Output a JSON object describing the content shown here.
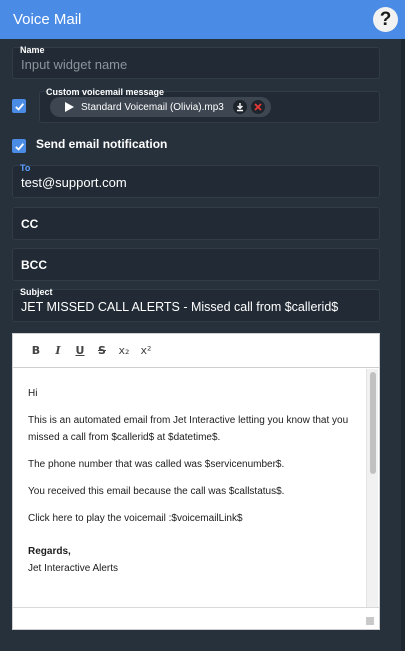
{
  "title": "Voice Mail",
  "help_icon": "?",
  "name_field": {
    "label": "Name",
    "placeholder": "Input widget name"
  },
  "custom_voicemail": {
    "label": "Custom voicemail message",
    "file_name": "Standard Voicemail (Olivia).mp3",
    "checked": true
  },
  "send_email": {
    "label": "Send email notification",
    "checked": true
  },
  "to_field": {
    "label": "To",
    "value": "test@support.com"
  },
  "cc_field": {
    "label": "CC"
  },
  "bcc_field": {
    "label": "BCC"
  },
  "subject_field": {
    "label": "Subject",
    "value": "JET MISSED CALL ALERTS - Missed call from $callerid$"
  },
  "editor": {
    "toolbar": {
      "bold": "B",
      "italic": "I",
      "underline": "U",
      "strike": "S",
      "subscript": "x₂",
      "superscript": "x²"
    },
    "body": {
      "greeting": "Hi",
      "line1": "This is an automated email from Jet Interactive letting you know that you missed a call from $callerid$ at $datetime$.",
      "line2": "The phone number that was called was $servicenumber$.",
      "line3": "You received this email because the call was $callstatus$.",
      "line4": "Click here to play the voicemail :$voicemailLink$",
      "signoff": "Regards,",
      "signature": "Jet Interactive Alerts"
    }
  },
  "colors": {
    "accent": "#4a8be5",
    "background": "#27313c",
    "field_bg": "#222b35",
    "delete": "#e53935"
  }
}
